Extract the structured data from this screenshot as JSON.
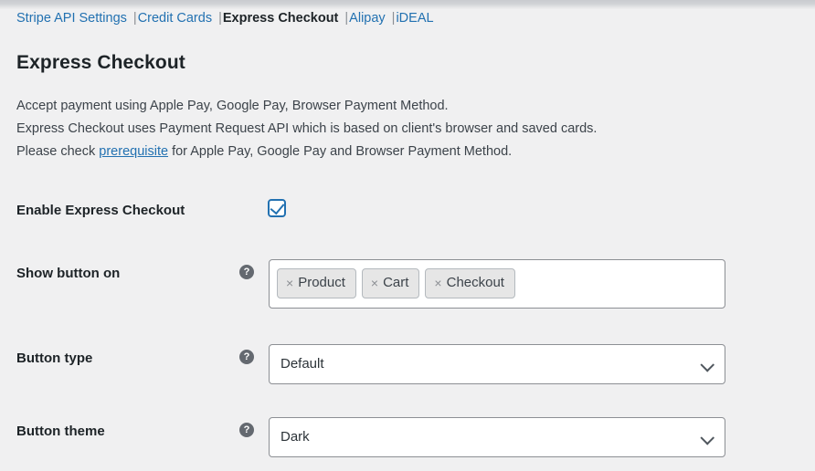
{
  "nav": {
    "items": [
      {
        "label": "Stripe API Settings",
        "current": false
      },
      {
        "label": "Credit Cards",
        "current": false
      },
      {
        "label": "Express Checkout",
        "current": true
      },
      {
        "label": "Alipay",
        "current": false
      },
      {
        "label": "iDEAL",
        "current": false
      }
    ],
    "separator": "|"
  },
  "page": {
    "title": "Express Checkout"
  },
  "description": {
    "line1": "Accept payment using Apple Pay, Google Pay, Browser Payment Method.",
    "line2": "Express Checkout uses Payment Request API which is based on client's browser and saved cards.",
    "line3_before": "Please check ",
    "line3_link": "prerequisite",
    "line3_after": " for Apple Pay, Google Pay and Browser Payment Method."
  },
  "fields": {
    "enable": {
      "label": "Enable Express Checkout",
      "checked": true,
      "checkbox_accent": "#2271b1"
    },
    "show_button_on": {
      "label": "Show button on",
      "help_icon": "question-mark-icon",
      "help_glyph": "?",
      "tokens": [
        {
          "label": "Product",
          "remove_glyph": "×"
        },
        {
          "label": "Cart",
          "remove_glyph": "×"
        },
        {
          "label": "Checkout",
          "remove_glyph": "×"
        }
      ]
    },
    "button_type": {
      "label": "Button type",
      "help_icon": "question-mark-icon",
      "help_glyph": "?",
      "value": "Default"
    },
    "button_theme": {
      "label": "Button theme",
      "help_icon": "question-mark-icon",
      "help_glyph": "?",
      "value": "Dark"
    }
  },
  "colors": {
    "background": "#f0f0f1",
    "link": "#2271b1",
    "text": "#1d2327",
    "muted": "#646970",
    "border": "#8c8f94",
    "token_bg": "#e6e6e6"
  }
}
